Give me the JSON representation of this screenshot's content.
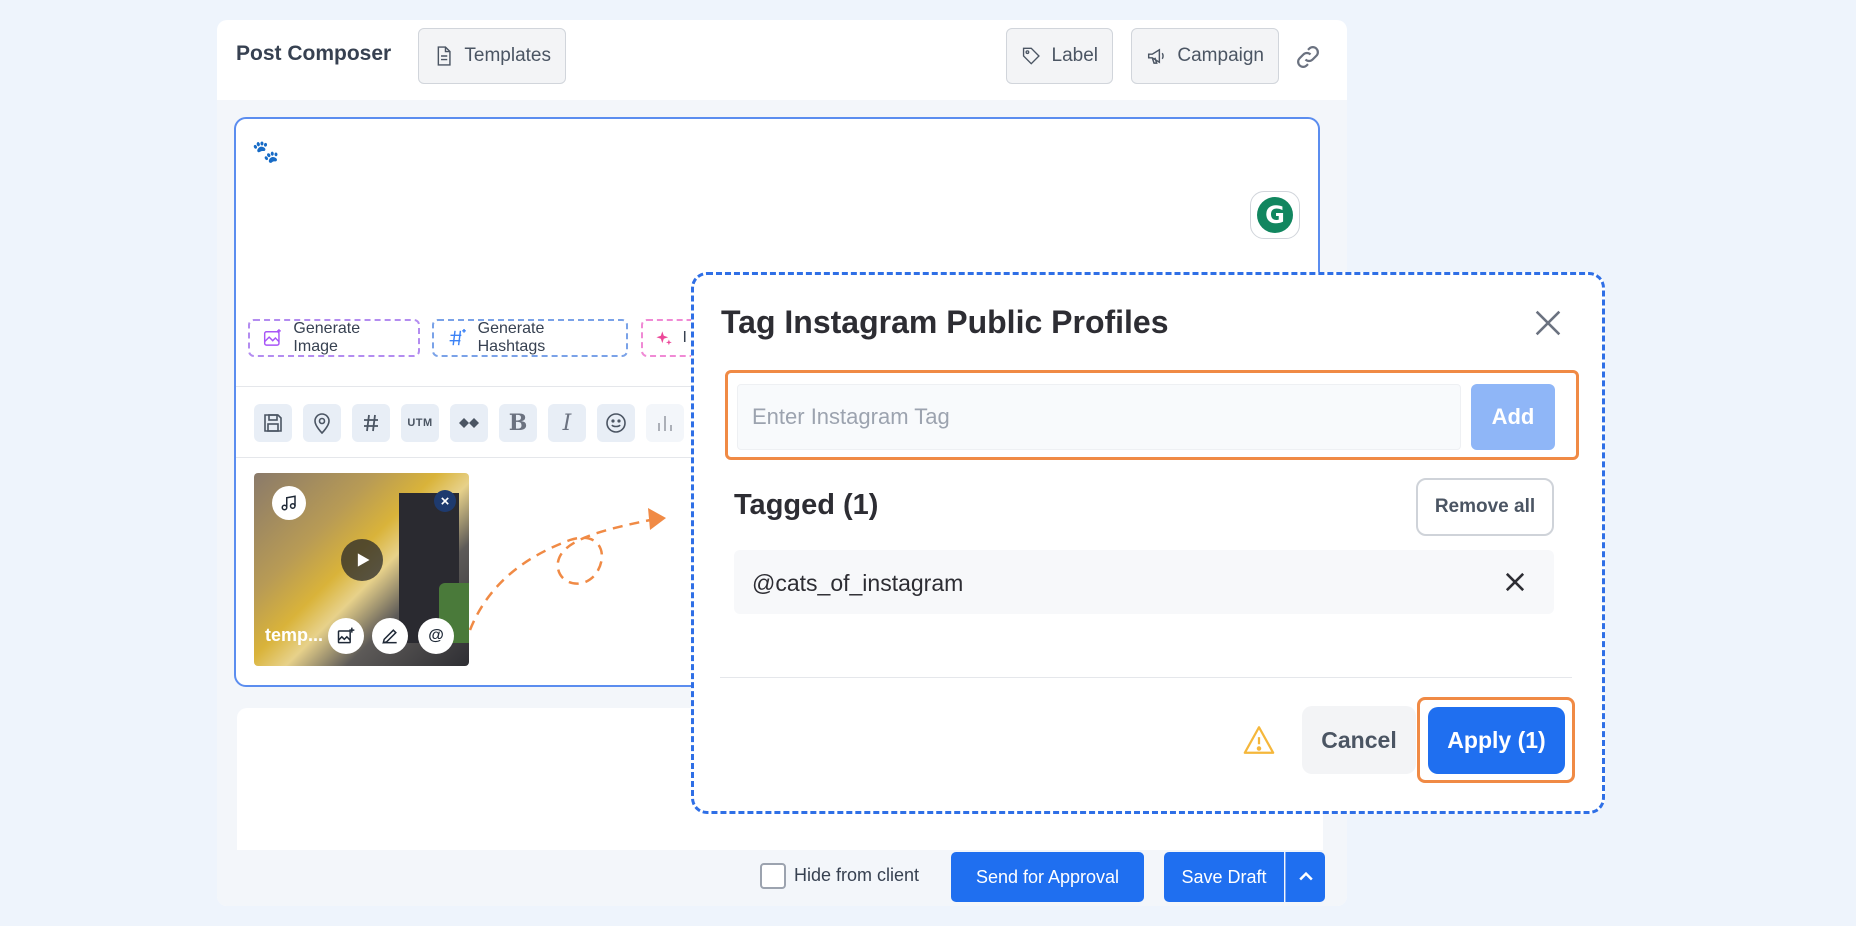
{
  "composer": {
    "title": "Post Composer",
    "templates_label": "Templates",
    "label_label": "Label",
    "campaign_label": "Campaign"
  },
  "ai_buttons": {
    "generate_image": "Generate Image",
    "generate_hashtags": "Generate Hashtags",
    "more_partial": "I"
  },
  "toolbar": {
    "icons": [
      "save-icon",
      "location-icon",
      "hashtag-icon",
      "utm-icon",
      "snippet-icon",
      "bold-icon",
      "italic-icon",
      "emoji-icon",
      "chart-icon"
    ],
    "utm_label": "UTM",
    "bold_label": "B",
    "italic_label": "I"
  },
  "media": {
    "filename": "temp...",
    "mention_symbol": "@"
  },
  "footer": {
    "hide_from_client": "Hide from client",
    "hide_from_client_checked": false,
    "send_for_approval": "Send for Approval",
    "save_draft": "Save Draft"
  },
  "modal": {
    "title": "Tag Instagram Public Profiles",
    "input_placeholder": "Enter Instagram Tag",
    "input_value": "",
    "add_label": "Add",
    "tagged_title": "Tagged (1)",
    "remove_all_label": "Remove all",
    "tags": [
      "@cats_of_instagram"
    ],
    "cancel_label": "Cancel",
    "apply_label": "Apply (1)"
  },
  "colors": {
    "accent": "#1f6ff0",
    "highlight": "#f08a45",
    "modal_border": "#2f6fe6",
    "grammarly": "#11865f"
  }
}
